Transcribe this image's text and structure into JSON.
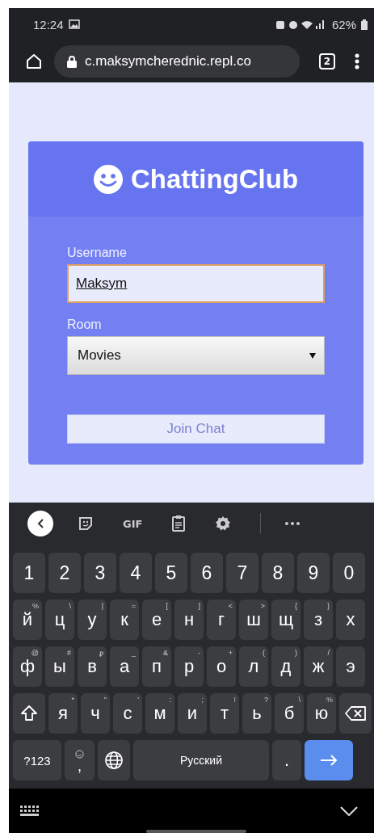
{
  "status_bar": {
    "time": "12:24",
    "battery": "62%"
  },
  "browser": {
    "url": "c.maksymcherednic.repl.co",
    "tab_count": "2"
  },
  "app": {
    "title": "ChattingClub",
    "username": {
      "label": "Username",
      "value": "Maksym",
      "focused": true
    },
    "room": {
      "label": "Room",
      "value": "Movies"
    },
    "join_button": "Join Chat"
  },
  "keyboard": {
    "toolbar": [
      {
        "kind": "back"
      },
      {
        "kind": "sticker"
      },
      {
        "kind": "gif",
        "label": "GIF"
      },
      {
        "kind": "clipboard"
      },
      {
        "kind": "settings"
      },
      {
        "kind": "more"
      }
    ],
    "key_rows": [
      {
        "keys": [
          {
            "kind": "char",
            "label": "1"
          },
          {
            "kind": "char",
            "label": "2"
          },
          {
            "kind": "char",
            "label": "3"
          },
          {
            "kind": "char",
            "label": "4"
          },
          {
            "kind": "char",
            "label": "5"
          },
          {
            "kind": "char",
            "label": "6"
          },
          {
            "kind": "char",
            "label": "7"
          },
          {
            "kind": "char",
            "label": "8"
          },
          {
            "kind": "char",
            "label": "9"
          },
          {
            "kind": "char",
            "label": "0"
          }
        ]
      },
      {
        "keys": [
          {
            "kind": "char",
            "label": "й",
            "hint": "%"
          },
          {
            "kind": "char",
            "label": "ц",
            "hint": "\\"
          },
          {
            "kind": "char",
            "label": "у",
            "hint": "|"
          },
          {
            "kind": "char",
            "label": "к",
            "hint": "="
          },
          {
            "kind": "char",
            "label": "е",
            "hint": "["
          },
          {
            "kind": "char",
            "label": "н",
            "hint": "]"
          },
          {
            "kind": "char",
            "label": "г",
            "hint": "<"
          },
          {
            "kind": "char",
            "label": "ш",
            "hint": ">"
          },
          {
            "kind": "char",
            "label": "щ",
            "hint": "{"
          },
          {
            "kind": "char",
            "label": "з",
            "hint": "}"
          },
          {
            "kind": "char",
            "label": "х"
          }
        ]
      },
      {
        "keys": [
          {
            "kind": "char",
            "label": "ф",
            "hint": "@"
          },
          {
            "kind": "char",
            "label": "ы",
            "hint": "#"
          },
          {
            "kind": "char",
            "label": "в",
            "hint": "₽"
          },
          {
            "kind": "char",
            "label": "а",
            "hint": "_"
          },
          {
            "kind": "char",
            "label": "п",
            "hint": "&"
          },
          {
            "kind": "char",
            "label": "р",
            "hint": "-"
          },
          {
            "kind": "char",
            "label": "о",
            "hint": "+"
          },
          {
            "kind": "char",
            "label": "л",
            "hint": "("
          },
          {
            "kind": "char",
            "label": "д",
            "hint": ")"
          },
          {
            "kind": "char",
            "label": "ж",
            "hint": "/"
          },
          {
            "kind": "char",
            "label": "э"
          }
        ]
      },
      {
        "keys": [
          {
            "kind": "shift"
          },
          {
            "kind": "char",
            "label": "я",
            "hint": "*"
          },
          {
            "kind": "char",
            "label": "ч",
            "hint": "\""
          },
          {
            "kind": "char",
            "label": "с",
            "hint": "'"
          },
          {
            "kind": "char",
            "label": "м",
            "hint": ":"
          },
          {
            "kind": "char",
            "label": "и",
            "hint": ";"
          },
          {
            "kind": "char",
            "label": "т",
            "hint": "!"
          },
          {
            "kind": "char",
            "label": "ь",
            "hint": "?"
          },
          {
            "kind": "char",
            "label": "б",
            "hint": "\\"
          },
          {
            "kind": "char",
            "label": "ю",
            "hint": "%"
          },
          {
            "kind": "backspace"
          }
        ]
      },
      {
        "keys": [
          {
            "kind": "symbols",
            "label": "?123"
          },
          {
            "kind": "comma",
            "label": ","
          },
          {
            "kind": "globe"
          },
          {
            "kind": "space",
            "label": "Русский"
          },
          {
            "kind": "period",
            "label": "."
          },
          {
            "kind": "enter"
          }
        ]
      }
    ]
  }
}
